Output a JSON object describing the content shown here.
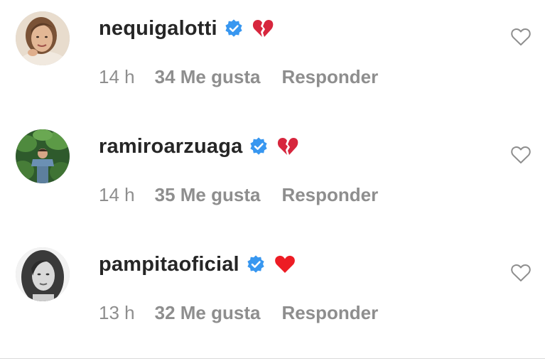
{
  "colors": {
    "username": "#262626",
    "meta": "#8e8e8e",
    "verified_badge": "#3897f0",
    "heart_red": "#ed1c24",
    "like_icon": "#8e8e8e"
  },
  "comments": [
    {
      "username": "nequigalotti",
      "verified": true,
      "emoji_icon": "broken-heart-icon",
      "time": "14 h",
      "likes": "34 Me gusta",
      "reply": "Responder"
    },
    {
      "username": "ramiroarzuaga",
      "verified": true,
      "emoji_icon": "broken-heart-icon",
      "time": "14 h",
      "likes": "35 Me gusta",
      "reply": "Responder"
    },
    {
      "username": "pampitaoficial",
      "verified": true,
      "emoji_icon": "red-heart-icon",
      "time": "13 h",
      "likes": "32 Me gusta",
      "reply": "Responder"
    }
  ]
}
